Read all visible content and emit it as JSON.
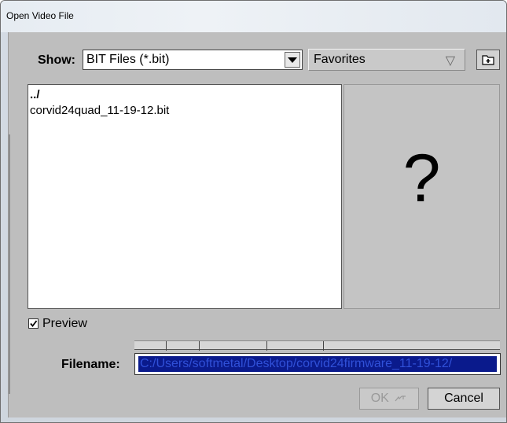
{
  "window": {
    "title": "Open Video File"
  },
  "show": {
    "label": "Show:",
    "selected": "BIT Files (*.bit)"
  },
  "favorites": {
    "label": "Favorites",
    "dropdown_glyph": "▽"
  },
  "new_folder_icon": "new-folder-icon",
  "files": [
    {
      "name": "../"
    },
    {
      "name": "corvid24quad_11-19-12.bit"
    }
  ],
  "preview_pane": {
    "placeholder": "?"
  },
  "preview_toggle": {
    "label": "Preview",
    "checked": true
  },
  "filename": {
    "label": "Filename:",
    "value": "C:/Users/softmetal/Desktop/corvid24firmware_11-19-12/"
  },
  "buttons": {
    "ok": "OK",
    "cancel": "Cancel"
  },
  "colors": {
    "selection_bg": "#0a1a8c",
    "selection_text": "#3050d8",
    "dialog_bg": "#bebebe"
  }
}
